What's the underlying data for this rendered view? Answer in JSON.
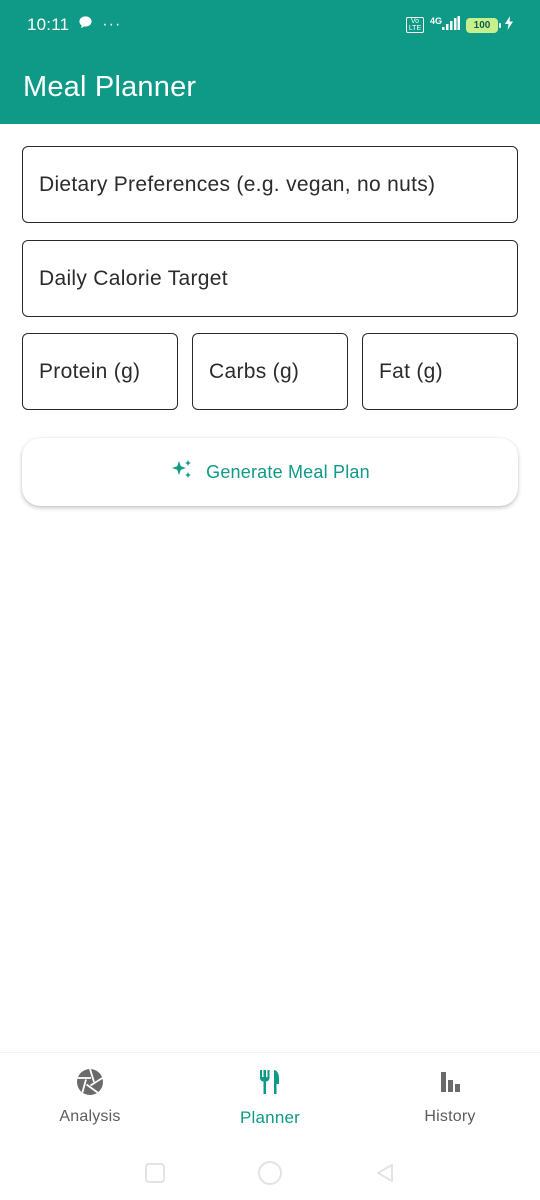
{
  "status_bar": {
    "time": "10:11",
    "ellipsis": "···",
    "volte_top": "Vo",
    "volte_bottom": "LTE",
    "network": "4G",
    "battery": "100"
  },
  "app_bar": {
    "title": "Meal Planner"
  },
  "form": {
    "dietary_placeholder": "Dietary Preferences (e.g. vegan, no nuts)",
    "calorie_placeholder": "Daily Calorie Target",
    "protein_placeholder": "Protein (g)",
    "carbs_placeholder": "Carbs (g)",
    "fat_placeholder": "Fat (g)"
  },
  "generate_button": {
    "label": "Generate Meal Plan",
    "icon": "sparkle-icon"
  },
  "bottom_nav": {
    "items": [
      {
        "label": "Analysis",
        "icon": "camera-aperture-icon",
        "active": false
      },
      {
        "label": "Planner",
        "icon": "fork-knife-icon",
        "active": true
      },
      {
        "label": "History",
        "icon": "bar-chart-icon",
        "active": false
      }
    ]
  },
  "colors": {
    "primary": "#0f9987",
    "text": "#2b2b2b",
    "inactive": "#5c5c5c"
  }
}
